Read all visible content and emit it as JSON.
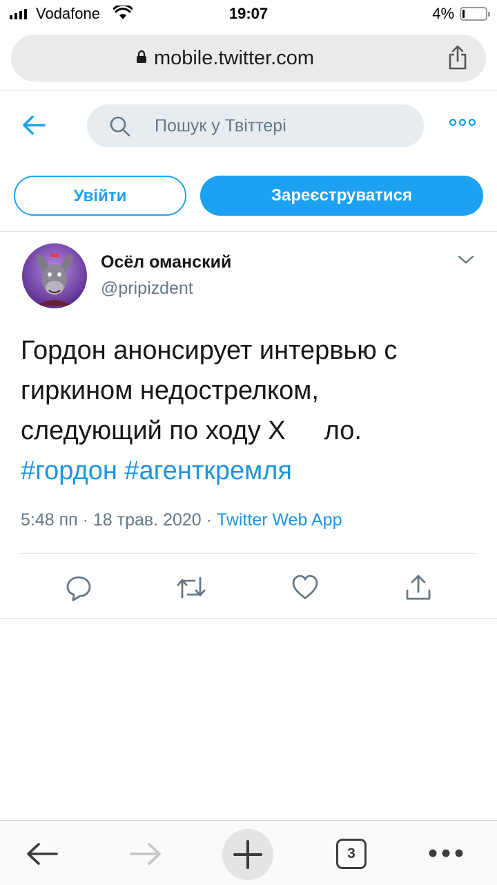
{
  "status_bar": {
    "carrier": "Vodafone",
    "time": "19:07",
    "battery_percent": "4%"
  },
  "browser": {
    "url": "mobile.twitter.com",
    "open_tabs": "3"
  },
  "twitter_header": {
    "search_placeholder": "Пошук у Твіттері",
    "login_label": "Увійти",
    "signup_label": "Зареєструватися"
  },
  "tweet": {
    "author_name": "Осёл оманский",
    "author_handle": "@pripizdent",
    "text_line1": "Гордон анонсирует интервью с",
    "text_line2": "гиркином недострелком,",
    "text_line3_before": "следующий по ходу Х",
    "text_line3_after": "ло.",
    "hashtags": "#гордон #агенткремля",
    "timestamp": "5:48 пп · 18 трав. 2020 · ",
    "source": "Twitter Web App"
  },
  "colors": {
    "twitter_blue": "#1da1f2",
    "link_blue": "#1b95e0",
    "secondary_text": "#657786"
  },
  "icons": [
    "signal-icon",
    "wifi-icon",
    "battery-icon",
    "lock-icon",
    "share-icon",
    "back-arrow-icon",
    "search-icon",
    "more-icon",
    "chevron-down-icon",
    "reply-icon",
    "retweet-icon",
    "like-icon",
    "share-tweet-icon",
    "browser-back-icon",
    "browser-forward-icon",
    "new-tab-icon",
    "tabs-icon",
    "menu-icon"
  ]
}
